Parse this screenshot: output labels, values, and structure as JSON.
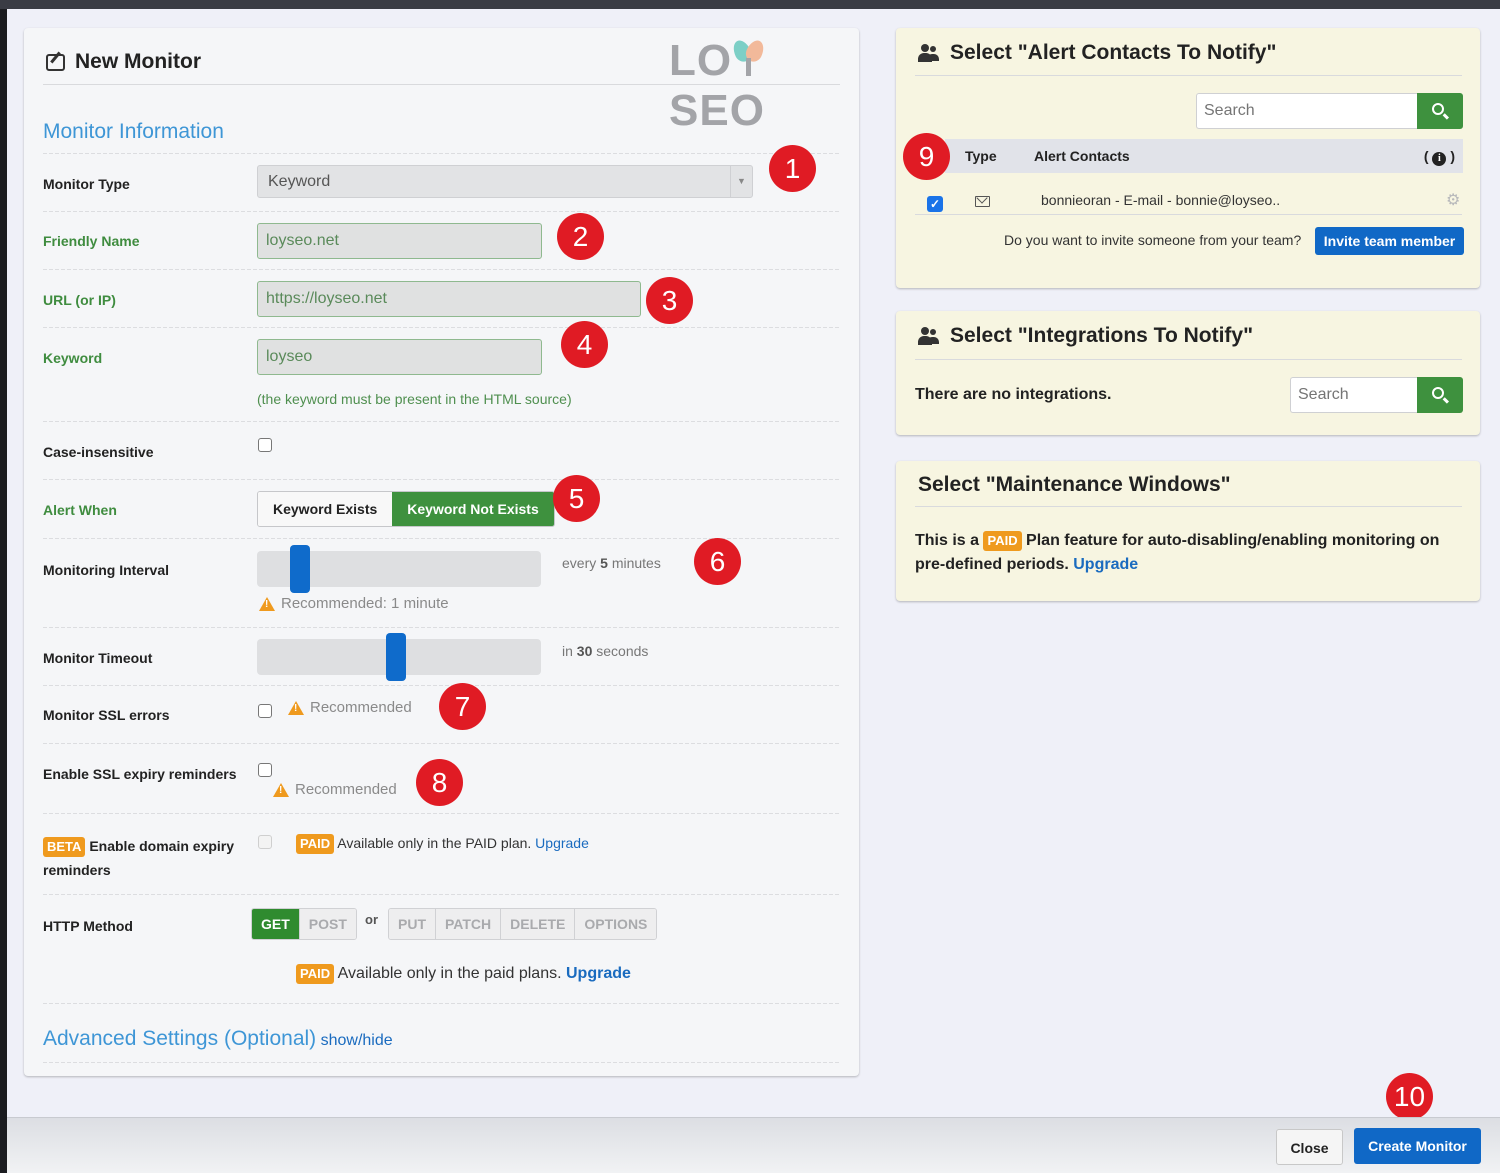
{
  "logo": {
    "left": "LO",
    "right": "SEO"
  },
  "left_panel": {
    "title": "New Monitor",
    "section_title": "Monitor Information",
    "fields": {
      "monitor_type": {
        "label": "Monitor Type",
        "value": "Keyword"
      },
      "friendly_name": {
        "label": "Friendly Name",
        "value": "loyseo.net"
      },
      "url": {
        "label": "URL (or IP)",
        "value": "https://loyseo.net"
      },
      "keyword": {
        "label": "Keyword",
        "value": "loyseo",
        "hint": "(the keyword must be present in the HTML source)"
      },
      "case_insensitive": {
        "label": "Case-insensitive",
        "checked": false
      },
      "alert_when": {
        "label": "Alert When",
        "options": [
          "Keyword Exists",
          "Keyword Not Exists"
        ],
        "selected": "Keyword Not Exists"
      },
      "monitoring_interval": {
        "label": "Monitoring Interval",
        "prefix": "every",
        "value": "5",
        "unit": "minutes",
        "slider_fraction": 0.15,
        "warning": "Recommended: 1 minute"
      },
      "monitor_timeout": {
        "label": "Monitor Timeout",
        "prefix": "in",
        "value": "30",
        "unit": "seconds",
        "slider_fraction": 0.49
      },
      "ssl_errors": {
        "label": "Monitor SSL errors",
        "checked": false,
        "warning": "Recommended"
      },
      "ssl_expiry": {
        "label": "Enable SSL expiry reminders",
        "checked": false,
        "warning": "Recommended"
      },
      "domain_expiry": {
        "badge": "BETA",
        "label_line1": "Enable domain expiry",
        "label_line2": "reminders",
        "paid_badge": "PAID",
        "paid_text": "Available only in the PAID plan.",
        "upgrade": "Upgrade"
      },
      "http_method": {
        "label": "HTTP Method",
        "primary": [
          "GET",
          "POST"
        ],
        "or": "or",
        "secondary": [
          "PUT",
          "PATCH",
          "DELETE",
          "OPTIONS"
        ],
        "selected": "GET",
        "paid_badge": "PAID",
        "paid_text": "Available only in the paid plans.",
        "upgrade": "Upgrade"
      }
    },
    "advanced": {
      "title": "Advanced Settings (Optional)",
      "toggle": "show/hide"
    }
  },
  "alert_contacts": {
    "title": "Select \"Alert Contacts To Notify\"",
    "search_placeholder": "Search",
    "columns": {
      "type": "Type",
      "contacts": "Alert Contacts",
      "info_open": "(",
      "info_close": ")"
    },
    "rows": [
      {
        "checked": true,
        "type": "email",
        "text": "bonnieoran - E-mail - bonnie@loyseo.."
      }
    ],
    "invite_prompt": "Do you want to invite someone from your team?",
    "invite_button": "Invite team member"
  },
  "integrations": {
    "title": "Select \"Integrations To Notify\"",
    "empty_text": "There are no integrations.",
    "search_placeholder": "Search"
  },
  "maintenance": {
    "title": "Select \"Maintenance Windows\"",
    "text_before": "This is a",
    "badge": "PAID",
    "text_after": "Plan feature for auto-disabling/enabling monitoring on pre-defined periods.",
    "upgrade": "Upgrade"
  },
  "footer": {
    "close": "Close",
    "create": "Create Monitor"
  },
  "annotations": [
    "1",
    "2",
    "3",
    "4",
    "5",
    "6",
    "7",
    "8",
    "9",
    "10"
  ],
  "colors": {
    "primary_blue": "#1068c6",
    "green": "#3e913e",
    "paid_orange": "#ef9a1e",
    "annotation_red": "#e01b24",
    "section_blue": "#3e96d6"
  }
}
